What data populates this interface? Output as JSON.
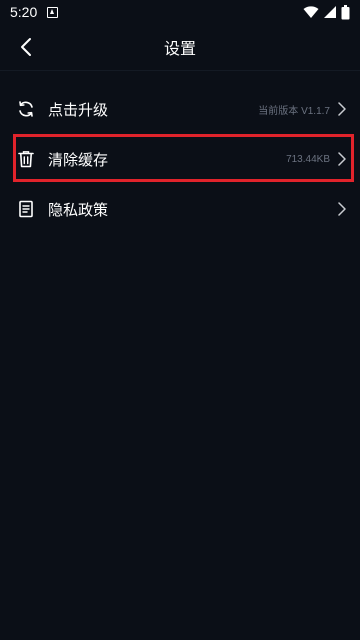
{
  "status_bar": {
    "time": "5:20"
  },
  "header": {
    "title": "设置"
  },
  "settings": [
    {
      "label": "点击升级",
      "value": "当前版本 V1.1.7",
      "icon": "refresh-icon"
    },
    {
      "label": "清除缓存",
      "value": "713.44KB",
      "icon": "trash-icon"
    },
    {
      "label": "隐私政策",
      "value": "",
      "icon": "document-icon"
    }
  ],
  "colors": {
    "background": "#0b0f17",
    "highlight": "#e1232b",
    "secondary_text": "#6b7280"
  }
}
